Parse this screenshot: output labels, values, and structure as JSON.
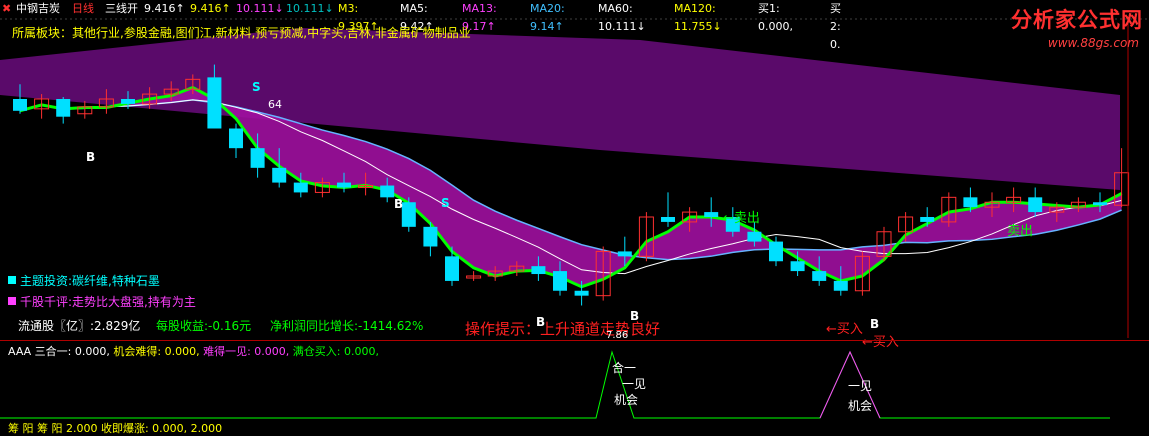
{
  "header": {
    "stock": "中钢吉炭",
    "period": "日线",
    "indicator": "三线开",
    "values": [
      {
        "text": "9.416↑",
        "color": "#ffffff"
      },
      {
        "text": "9.416↑",
        "color": "#ffff00"
      },
      {
        "text": "10.111↓",
        "color": "#ff40ff"
      },
      {
        "text": "10.111↓",
        "color": "#00c0c0"
      },
      {
        "text": "M3: 9.397↑",
        "color": "#ffff00"
      },
      {
        "text": "MA5: 9.42↑",
        "color": "#ffffff"
      },
      {
        "text": "MA13: 9.17↑",
        "color": "#ff40ff"
      },
      {
        "text": "MA20: 9.14↑",
        "color": "#40c0ff"
      },
      {
        "text": "MA60: 10.111↓",
        "color": "#ffffff"
      },
      {
        "text": "MA120: 11.755↓",
        "color": "#ffff00"
      },
      {
        "text": "买1: 0.000,",
        "color": "#ffffff"
      },
      {
        "text": "买2: 0.",
        "color": "#ffffff"
      }
    ]
  },
  "sector": {
    "label": "所属板块：其他行业,参股金融,图们江,新材料,预亏预减,中字头,吉林,非金属矿物制品业",
    "color": "#ffff00"
  },
  "theme": {
    "label": "主题投资:碳纤维,特种石墨",
    "color": "#00ffff"
  },
  "review": {
    "label": "千股千评:走势比大盘强,持有为主",
    "color": "#ff40ff"
  },
  "stats": {
    "float_label": "流通股〖亿〗:2.829亿",
    "eps_label": "每股收益:-0.16元",
    "growth_label": "净利润同比增长:-1414.62%"
  },
  "tip": {
    "label": "操作提示：上升通道走势良好",
    "color": "#ff2020"
  },
  "signals": {
    "sell": "S",
    "buy": "B",
    "sell_text": "卖出",
    "buy_text": "买入",
    "high": "64",
    "low": "7.86"
  },
  "lower": {
    "title": "AAA 三合一: 0.000,",
    "items": [
      {
        "text": "机会难得: 0.000,",
        "color": "#ffff00"
      },
      {
        "text": "难得一见: 0.000,",
        "color": "#ff40ff"
      },
      {
        "text": "满仓买入: 0.000,",
        "color": "#00ff00"
      }
    ],
    "peak1": [
      "合一",
      "一见",
      "机会"
    ],
    "peak2": [
      "一见",
      "机会"
    ],
    "bottom_label": "筹 阳 筹 阳 2.000  收即爆涨: 0.000, 2.000"
  },
  "logo": {
    "title": "分析家公式网",
    "url": "www.88gs.com"
  },
  "colors": {
    "up": "#ff3030",
    "down": "#00e0ff",
    "ma_green": "#00ff00",
    "ma_blue": "#66b3ff",
    "magenta": "#a010a0",
    "purple": "#5a0a6a"
  },
  "chart_data": {
    "type": "candlestick",
    "candles": [
      [
        9.7,
        9.85,
        9.55,
        9.58
      ],
      [
        9.6,
        9.75,
        9.5,
        9.7
      ],
      [
        9.7,
        9.72,
        9.45,
        9.52
      ],
      [
        9.55,
        9.68,
        9.5,
        9.62
      ],
      [
        9.62,
        9.8,
        9.55,
        9.7
      ],
      [
        9.7,
        9.78,
        9.6,
        9.65
      ],
      [
        9.65,
        9.82,
        9.6,
        9.75
      ],
      [
        9.75,
        9.88,
        9.68,
        9.8
      ],
      [
        9.8,
        9.95,
        9.75,
        9.9
      ],
      [
        9.92,
        10.05,
        9.6,
        9.4
      ],
      [
        9.4,
        9.45,
        9.1,
        9.2
      ],
      [
        9.2,
        9.35,
        8.9,
        9.0
      ],
      [
        9.0,
        9.2,
        8.8,
        8.85
      ],
      [
        8.85,
        8.95,
        8.7,
        8.75
      ],
      [
        8.75,
        8.9,
        8.7,
        8.85
      ],
      [
        8.85,
        8.95,
        8.75,
        8.8
      ],
      [
        8.8,
        8.95,
        8.72,
        8.82
      ],
      [
        8.82,
        8.9,
        8.65,
        8.7
      ],
      [
        8.65,
        8.7,
        8.35,
        8.4
      ],
      [
        8.4,
        8.45,
        8.1,
        8.2
      ],
      [
        8.1,
        8.2,
        7.8,
        7.85
      ],
      [
        7.9,
        7.95,
        7.85,
        7.9
      ],
      [
        7.9,
        8.0,
        7.85,
        7.95
      ],
      [
        7.95,
        8.05,
        7.9,
        8.0
      ],
      [
        8.0,
        8.1,
        7.85,
        7.92
      ],
      [
        7.95,
        8.05,
        7.7,
        7.75
      ],
      [
        7.75,
        7.85,
        7.6,
        7.7
      ],
      [
        7.7,
        8.2,
        7.65,
        8.15
      ],
      [
        8.15,
        8.3,
        8.0,
        8.1
      ],
      [
        8.1,
        8.55,
        8.05,
        8.5
      ],
      [
        8.5,
        8.75,
        8.4,
        8.45
      ],
      [
        8.45,
        8.6,
        8.35,
        8.55
      ],
      [
        8.55,
        8.7,
        8.4,
        8.5
      ],
      [
        8.5,
        8.6,
        8.3,
        8.35
      ],
      [
        8.35,
        8.45,
        8.2,
        8.25
      ],
      [
        8.25,
        8.3,
        8.0,
        8.05
      ],
      [
        8.05,
        8.15,
        7.9,
        7.95
      ],
      [
        7.95,
        8.1,
        7.8,
        7.85
      ],
      [
        7.85,
        8.0,
        7.7,
        7.75
      ],
      [
        7.75,
        8.15,
        7.7,
        8.1
      ],
      [
        8.1,
        8.4,
        8.05,
        8.35
      ],
      [
        8.35,
        8.55,
        8.25,
        8.5
      ],
      [
        8.5,
        8.6,
        8.4,
        8.45
      ],
      [
        8.45,
        8.75,
        8.4,
        8.7
      ],
      [
        8.7,
        8.8,
        8.55,
        8.6
      ],
      [
        8.6,
        8.75,
        8.5,
        8.65
      ],
      [
        8.65,
        8.8,
        8.55,
        8.7
      ],
      [
        8.7,
        8.8,
        8.5,
        8.55
      ],
      [
        8.55,
        8.65,
        8.45,
        8.6
      ],
      [
        8.6,
        8.7,
        8.55,
        8.65
      ],
      [
        8.65,
        8.75,
        8.55,
        8.62
      ],
      [
        8.62,
        9.2,
        8.6,
        8.95
      ]
    ]
  }
}
